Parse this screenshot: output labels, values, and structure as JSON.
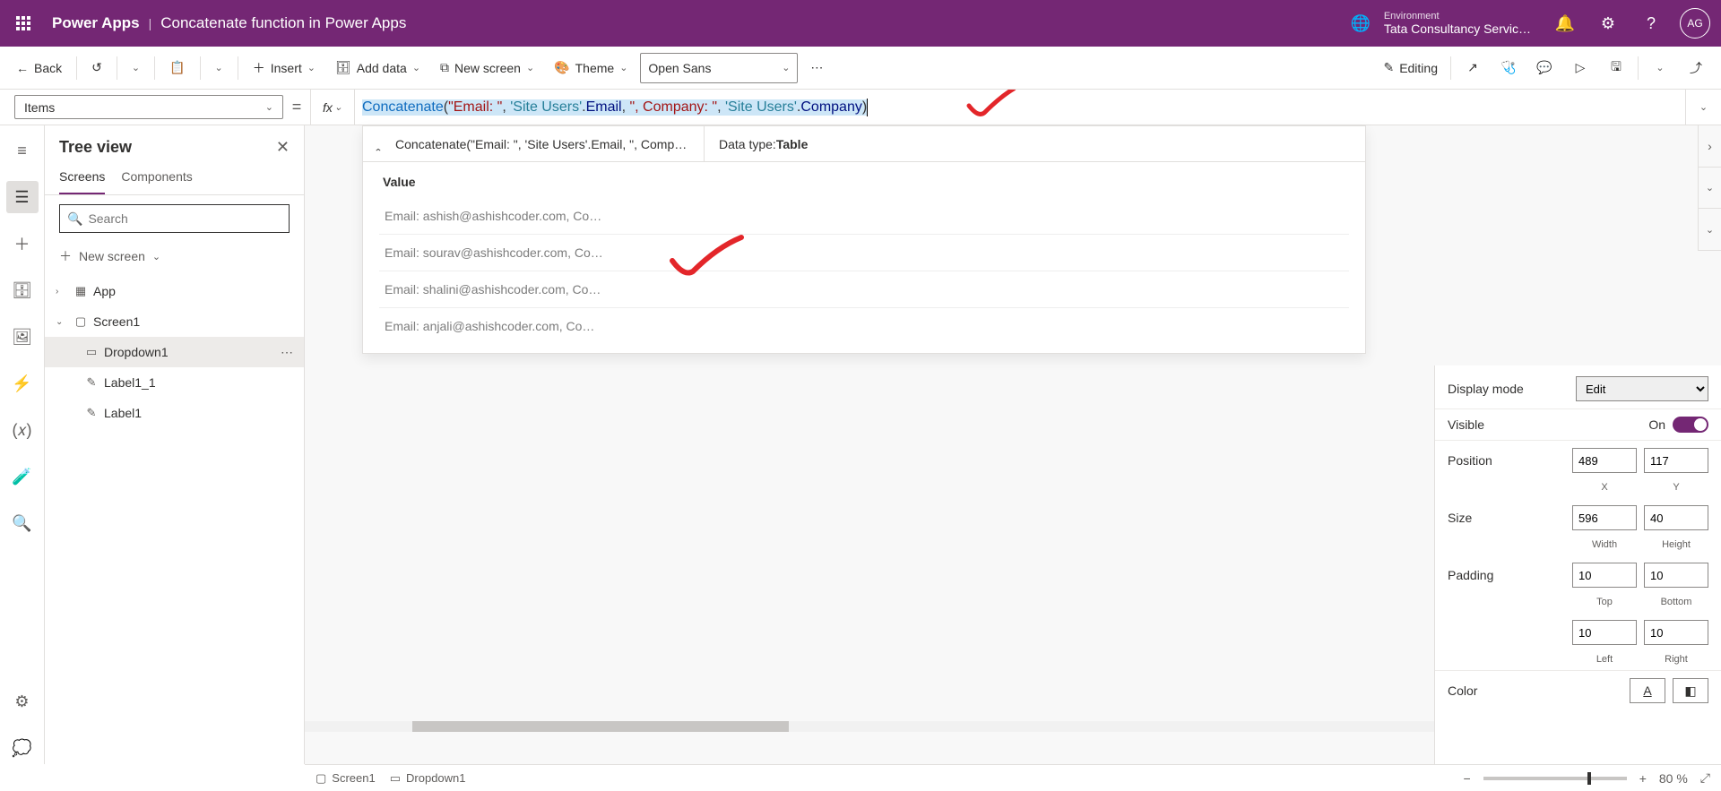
{
  "header": {
    "app": "Power Apps",
    "title": "Concatenate function in Power Apps",
    "envLabel": "Environment",
    "envValue": "Tata Consultancy Servic…",
    "avatar": "AG"
  },
  "toolbar": {
    "back": "Back",
    "insert": "Insert",
    "addData": "Add data",
    "newScreen": "New screen",
    "theme": "Theme",
    "font": "Open Sans",
    "editing": "Editing"
  },
  "formula": {
    "property": "Items",
    "text": "Concatenate(\"Email: \", 'Site Users'.Email, \", Company: \", 'Site Users'.Company)",
    "tokens": [
      {
        "t": "Concatenate",
        "c": "tok-fn"
      },
      {
        "t": "(",
        "c": "tok-p"
      },
      {
        "t": "\"Email: \"",
        "c": "tok-str"
      },
      {
        "t": ", ",
        "c": "tok-p"
      },
      {
        "t": "'Site Users'",
        "c": "tok-name"
      },
      {
        "t": ".",
        "c": "tok-p"
      },
      {
        "t": "Email",
        "c": "tok-prop"
      },
      {
        "t": ", ",
        "c": "tok-p"
      },
      {
        "t": "\", Company: \"",
        "c": "tok-str"
      },
      {
        "t": ", ",
        "c": "tok-p"
      },
      {
        "t": "'Site Users'",
        "c": "tok-name"
      },
      {
        "t": ".",
        "c": "tok-p"
      },
      {
        "t": "Company",
        "c": "tok-prop"
      },
      {
        "t": ")",
        "c": "tok-p"
      }
    ]
  },
  "result": {
    "summary": "Concatenate(\"Email: \", 'Site Users'.Email, \", Compa…",
    "dataTypeLabel": "Data type: ",
    "dataType": "Table",
    "valueHeader": "Value",
    "rows": [
      "Email: ashish@ashishcoder.com, Co…",
      "Email: sourav@ashishcoder.com, Co…",
      "Email: shalini@ashishcoder.com, Co…",
      "Email: anjali@ashishcoder.com, Co…"
    ]
  },
  "tree": {
    "title": "Tree view",
    "tabs": [
      "Screens",
      "Components"
    ],
    "searchPlaceholder": "Search",
    "newScreen": "New screen",
    "nodes": {
      "app": "App",
      "screen": "Screen1",
      "dropdown": "Dropdown1",
      "label1": "Label1_1",
      "label2": "Label1"
    }
  },
  "props": {
    "displayMode": {
      "label": "Display mode",
      "value": "Edit"
    },
    "visible": {
      "label": "Visible",
      "value": "On"
    },
    "position": {
      "label": "Position",
      "x": "489",
      "y": "117"
    },
    "positionSub": {
      "x": "X",
      "y": "Y"
    },
    "size": {
      "label": "Size",
      "w": "596",
      "h": "40"
    },
    "sizeSub": {
      "w": "Width",
      "h": "Height"
    },
    "padding": {
      "label": "Padding",
      "t": "10",
      "b": "10",
      "l": "10",
      "r": "10"
    },
    "paddingSub": {
      "t": "Top",
      "b": "Bottom",
      "l": "Left",
      "r": "Right"
    },
    "color": {
      "label": "Color"
    }
  },
  "status": {
    "screen": "Screen1",
    "dropdown": "Dropdown1",
    "zoom": "80",
    "zoomUnit": "%"
  }
}
